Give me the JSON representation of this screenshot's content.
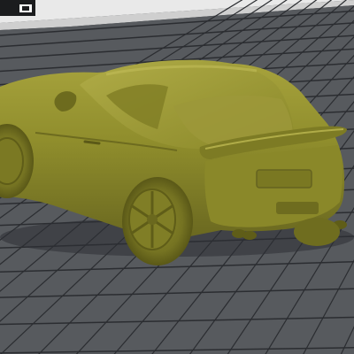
{
  "viewport": {
    "background_color": "#3a3d42",
    "bed_color": "#5a5d61",
    "bed_top_color": "#4f5256",
    "grid_line_color": "#2b2d31",
    "top_strip_color": "#e8e8e8",
    "model_color": "#8f8d2c",
    "model_shadow_color": "#5c5a17",
    "model_highlight_color": "#b3ae4a"
  },
  "corner_icon": {
    "name": "view-cube-icon"
  },
  "model": {
    "name": "car-model"
  }
}
